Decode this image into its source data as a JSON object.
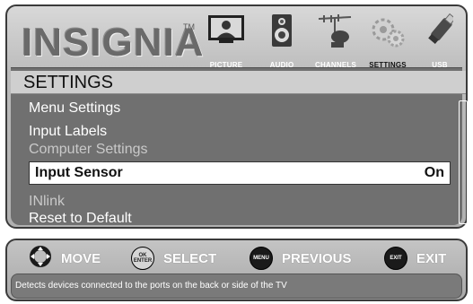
{
  "brand": {
    "logo_text": "INSIGNIA",
    "trademark": "TM"
  },
  "tabs": [
    {
      "id": "picture",
      "label": "PICTURE",
      "active": false
    },
    {
      "id": "audio",
      "label": "AUDIO",
      "active": false
    },
    {
      "id": "channels",
      "label": "CHANNELS",
      "active": false
    },
    {
      "id": "settings",
      "label": "SETTINGS",
      "active": true
    },
    {
      "id": "usb",
      "label": "USB",
      "active": false
    }
  ],
  "menu": {
    "title": "SETTINGS",
    "items": [
      {
        "label": "Menu Settings",
        "state": "normal"
      },
      {
        "label": "Input Labels",
        "state": "normal"
      },
      {
        "label": "Computer Settings",
        "state": "disabled"
      },
      {
        "label": "Input Sensor",
        "value": "On",
        "state": "selected"
      },
      {
        "label": "INlink",
        "state": "disabled"
      },
      {
        "label": "Reset to Default",
        "state": "normal"
      }
    ]
  },
  "nav": {
    "move": {
      "label": "MOVE",
      "icon": "dpad-icon"
    },
    "select": {
      "label": "SELECT",
      "button_text": "OK ENTER",
      "icon": "ok-enter-icon"
    },
    "previous": {
      "label": "PREVIOUS",
      "button_text": "MENU",
      "icon": "menu-button-icon"
    },
    "exit": {
      "label": "EXIT",
      "button_text": "EXIT",
      "icon": "exit-button-icon"
    }
  },
  "help_text": "Detects devices connected to the ports on the back or side of the TV",
  "colors": {
    "panel": "#b8b8b8",
    "menu_bg": "#707070",
    "selected_bg": "#ffffff",
    "text": "#ffffff",
    "disabled_text": "#c9c9c9"
  }
}
